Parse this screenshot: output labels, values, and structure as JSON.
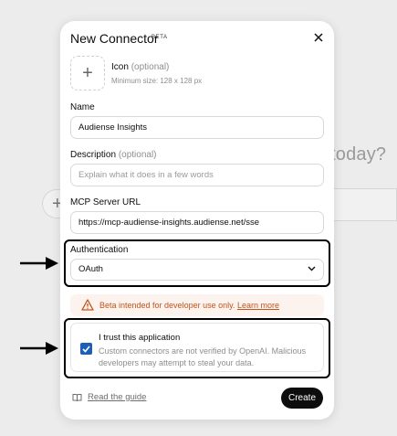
{
  "background": {
    "prompt_fragment": "today?"
  },
  "modal": {
    "title": "New Connector",
    "beta_tag": "BETA",
    "icon": {
      "label": "Icon",
      "optional": "(optional)",
      "hint": "Minimum size: 128 x 128 px",
      "upload_icon": "plus-icon"
    },
    "name": {
      "label": "Name",
      "value": "Audiense Insights"
    },
    "description": {
      "label": "Description",
      "optional": "(optional)",
      "placeholder": "Explain what it does in a few words"
    },
    "mcp_url": {
      "label": "MCP Server URL",
      "value": "https://mcp-audiense-insights.audiense.net/sse"
    },
    "authentication": {
      "label": "Authentication",
      "selected": "OAuth"
    },
    "warning": {
      "text": "Beta intended for developer use only.",
      "link": "Learn more",
      "color": "#c4531a"
    },
    "trust": {
      "checked": true,
      "title": "I trust this application",
      "description": "Custom connectors are not verified by OpenAI. Malicious developers may attempt to steal your data."
    },
    "footer": {
      "guide_link": "Read the guide",
      "create_button": "Create"
    }
  },
  "colors": {
    "accent": "#1d5eb6",
    "button": "#0d0d0d",
    "warning_bg": "#fdf3ee"
  }
}
